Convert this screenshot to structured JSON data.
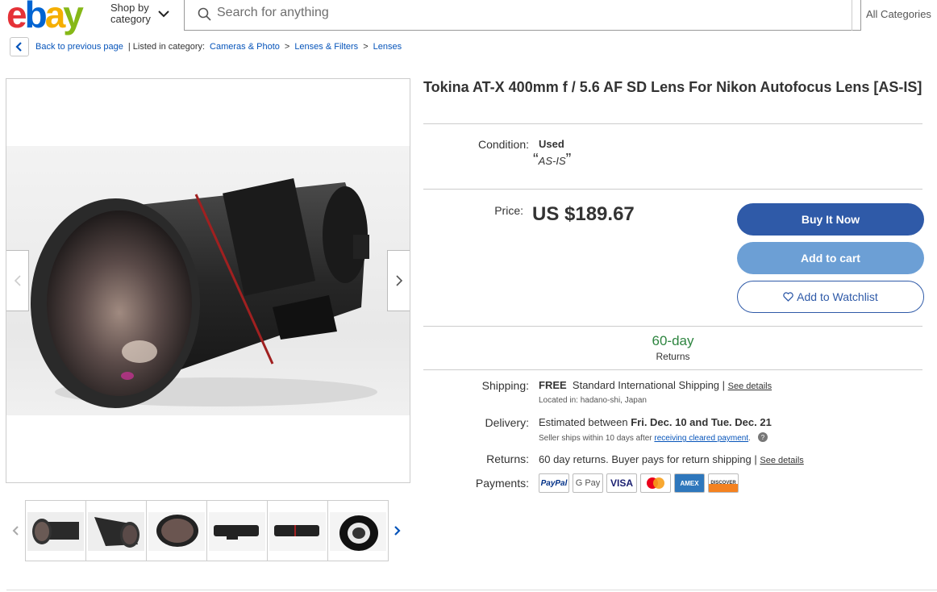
{
  "header": {
    "logo": {
      "e": "e",
      "b": "b",
      "a": "a",
      "y": "y"
    },
    "shop_by_line1": "Shop by",
    "shop_by_line2": "category",
    "search_placeholder": "Search for anything",
    "all_categories": "All Categories"
  },
  "breadcrumb": {
    "back": "Back to previous page",
    "listed_in": "| Listed in category:",
    "items": [
      "Cameras & Photo",
      "Lenses & Filters",
      "Lenses"
    ],
    "separator": ">"
  },
  "listing": {
    "title": "Tokina AT-X 400mm f / 5.6 AF SD Lens For Nikon Autofocus Lens [AS-IS]",
    "condition_label": "Condition:",
    "condition_value": "Used",
    "condition_note": "AS-IS",
    "price_label": "Price:",
    "price": "US $189.67",
    "buttons": {
      "buy": "Buy It Now",
      "cart": "Add to cart",
      "watch": "Add to Watchlist"
    },
    "returns_days": "60-day",
    "returns_word": "Returns",
    "shipping_label": "Shipping:",
    "shipping_free": "FREE",
    "shipping_text": "Standard International Shipping |",
    "shipping_link": "See details",
    "located_in": "Located in:  hadano-shi, Japan",
    "delivery_label": "Delivery:",
    "delivery_text": "Estimated between",
    "delivery_dates": "Fri. Dec. 10 and Tue. Dec. 21",
    "seller_ships": "Seller ships within 10 days after",
    "seller_ships_link": "receiving cleared payment",
    "returns_label": "Returns:",
    "returns_text": "60 day returns. Buyer pays for return shipping |",
    "returns_link": "See details",
    "payments_label": "Payments:",
    "payments": [
      "PayPal",
      "G Pay",
      "VISA",
      "Mastercard",
      "AMEX",
      "DISCOVER"
    ]
  },
  "colors": {
    "accent_blue": "#2f5aa8",
    "cart_blue": "#6c9fd5",
    "returns_green": "#2e8540",
    "link_blue": "#0654ba"
  },
  "icons": [
    "search-icon",
    "chevron-down-icon",
    "chevron-left-icon",
    "chevron-right-icon",
    "heart-icon",
    "help-icon"
  ]
}
